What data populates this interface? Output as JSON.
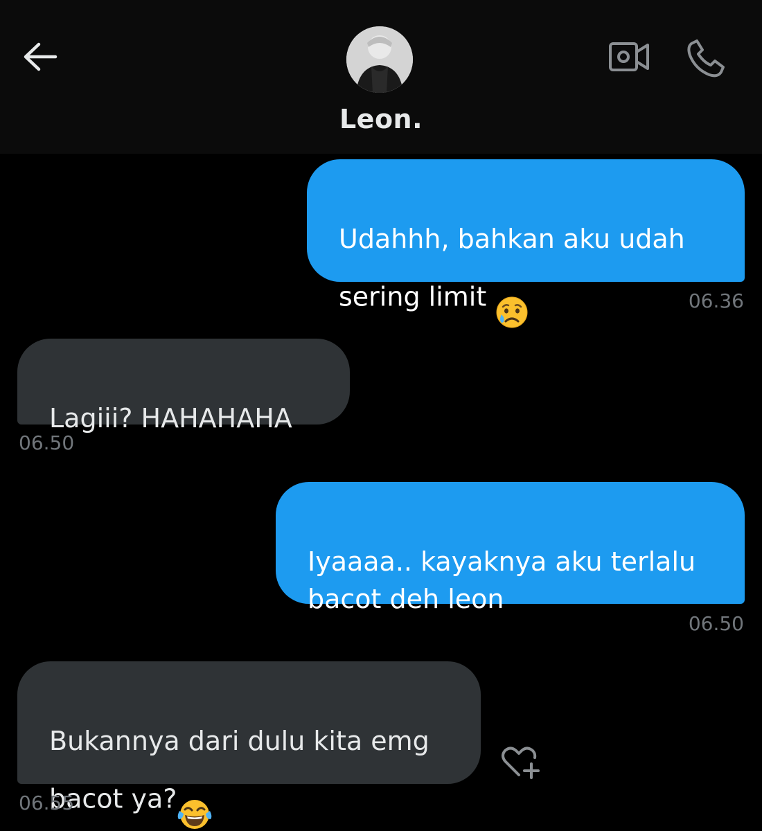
{
  "header": {
    "contact_name": "Leon.",
    "back_icon": "arrow-left-icon",
    "video_icon": "video-camera-icon",
    "call_icon": "phone-icon"
  },
  "messages": [
    {
      "direction": "outgoing",
      "text": "Udahhh, bahkan aku udah\nsering limit ",
      "emoji": "sad-but-relieved-face",
      "time": "06.36"
    },
    {
      "direction": "incoming",
      "text": "Lagiii? HAHAHAHA",
      "time": "06.50"
    },
    {
      "direction": "outgoing",
      "text": "Iyaaaa.. kayaknya aku terlalu\nbacot deh leon",
      "time": "06.50"
    },
    {
      "direction": "incoming",
      "text": "Bukannya dari dulu kita emg\nbacot ya?",
      "emoji": "face-with-tears-of-joy",
      "time": "06.55"
    }
  ],
  "reaction_icon": "heart-plus-icon",
  "colors": {
    "background": "#000000",
    "header_bg": "#0b0b0b",
    "outgoing_bubble": "#1d9bf0",
    "incoming_bubble": "#2f3336",
    "timestamp": "#71767b"
  }
}
